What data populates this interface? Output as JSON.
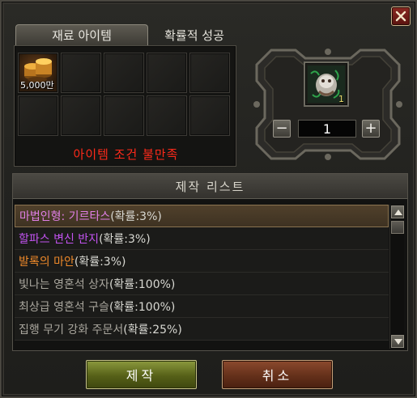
{
  "tabs": {
    "materials_label": "재료 아이템",
    "success_rate_label": "확률적 성공"
  },
  "materials": {
    "slots": [
      {
        "icon": "gold-coins-icon",
        "qty": "5,000만"
      },
      {},
      {},
      {},
      {},
      {},
      {},
      {},
      {},
      {}
    ],
    "warning": "아이템 조건 불만족"
  },
  "result": {
    "icon": "doll-item-icon",
    "count": "1",
    "quantity_value": "1",
    "minus_label": "−",
    "plus_label": "+"
  },
  "craft_list": {
    "header": "제작 리스트",
    "items": [
      {
        "label": "마법인형: 기르타스",
        "rate": " (확률:3%)",
        "color": "#e07fe6"
      },
      {
        "label": "할파스 변신 반지",
        "rate": " (확률:3%)",
        "color": "#c253f0"
      },
      {
        "label": "발록의 마안",
        "rate": " (확률:3%)",
        "color": "#f08a2a"
      },
      {
        "label": "빛나는 영혼석 상자",
        "rate": " (확률:100%)",
        "color": "#a9a69d"
      },
      {
        "label": "최상급 영혼석 구슬",
        "rate": " (확률:100%)",
        "color": "#a9a69d"
      },
      {
        "label": "집행 무기 강화 주문서",
        "rate": " (확률:25%)",
        "color": "#a9a69d"
      }
    ]
  },
  "buttons": {
    "craft_label": "제작",
    "cancel_label": "취소"
  },
  "colors": {
    "warning": "#ff2a1a",
    "rate_text": "#d8d8d2",
    "selected_row": "#50402b"
  }
}
